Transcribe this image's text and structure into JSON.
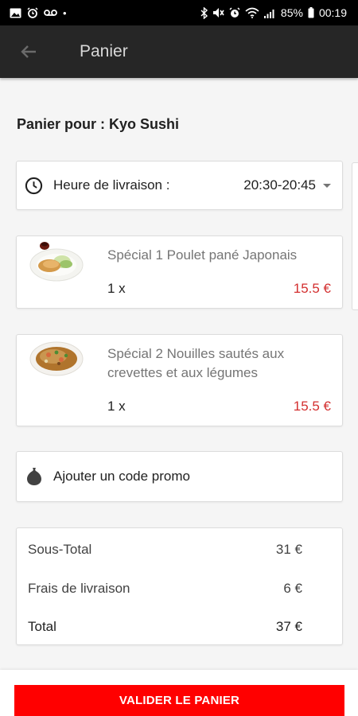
{
  "status_bar": {
    "battery_percent": "85%",
    "time": "00:19",
    "left_icons": [
      "image-icon",
      "alarm-icon",
      "voicemail-icon",
      "dot-icon"
    ],
    "right_icons": [
      "bluetooth-icon",
      "mute-icon",
      "alarm-icon",
      "wifi-icon",
      "signal-icon",
      "battery-icon"
    ]
  },
  "app_bar": {
    "title": "Panier",
    "back_icon": "arrow-left-icon"
  },
  "cart": {
    "header": "Panier pour : Kyo Sushi",
    "delivery": {
      "label": "Heure de livraison :",
      "value": "20:30-20:45",
      "icon": "clock-icon"
    },
    "items": [
      {
        "name": "Spécial 1 Poulet pané Japonais",
        "quantity": "1 x",
        "price": "15.5 €"
      },
      {
        "name": "Spécial 2 Nouilles sautés aux crevettes et aux légumes",
        "quantity": "1 x",
        "price": "15.5 €"
      }
    ],
    "promo": {
      "label": "Ajouter un code promo",
      "icon": "tag-icon"
    },
    "totals": {
      "subtotal_label": "Sous-Total",
      "subtotal_value": "31 €",
      "delivery_fee_label": "Frais de livraison",
      "delivery_fee_value": "6 €",
      "total_label": "Total",
      "total_value": "37 €"
    }
  },
  "footer": {
    "validate_label": "VALIDER LE PANIER"
  },
  "colors": {
    "app_bar": "#262626",
    "price": "#d32f2f",
    "validate_button": "#ff0000",
    "background": "#f5f5f5"
  }
}
